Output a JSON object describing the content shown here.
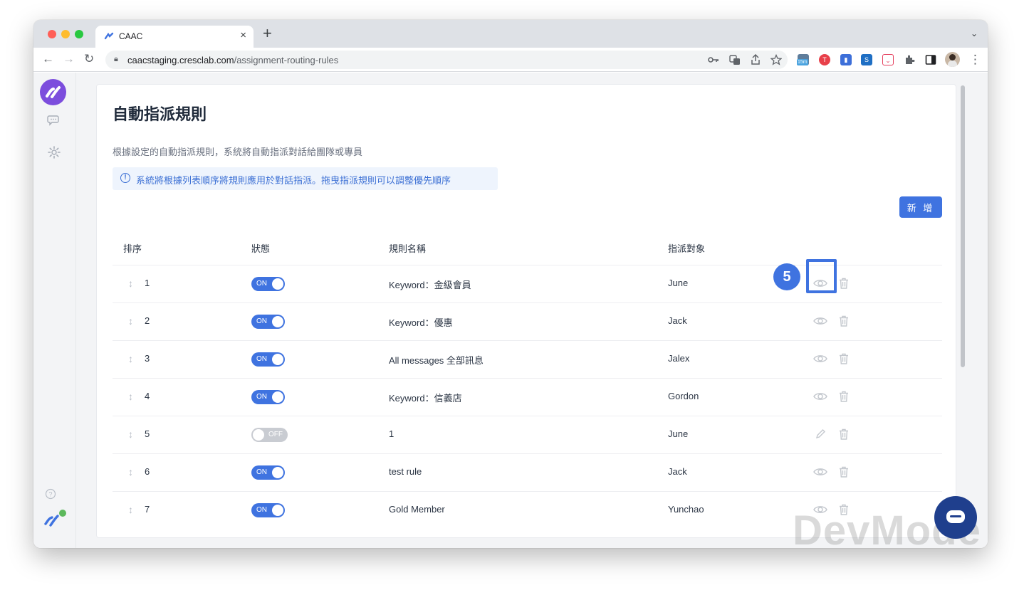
{
  "browser": {
    "tab_title": "CAAC",
    "url_host": "caacstaging.cresclab.com",
    "url_path": "/assignment-routing-rules",
    "ext_badge": "15m"
  },
  "page": {
    "title": "自動指派規則",
    "description": "根據設定的自動指派規則，系統將自動指派對話給團隊或專員",
    "info": "系統將根據列表順序將規則應用於對話指派。拖曳指派規則可以調整優先順序",
    "add_button": "新 增"
  },
  "table": {
    "headers": {
      "order": "排序",
      "status": "狀態",
      "rule_name": "規則名稱",
      "assignee": "指派對象"
    },
    "rows": [
      {
        "order": "1",
        "status": "ON",
        "name": "Keyword：金級會員",
        "assignee": "June",
        "action": "view"
      },
      {
        "order": "2",
        "status": "ON",
        "name": "Keyword：優惠",
        "assignee": "Jack",
        "action": "view"
      },
      {
        "order": "3",
        "status": "ON",
        "name": "All messages 全部訊息",
        "assignee": "Jalex",
        "action": "view"
      },
      {
        "order": "4",
        "status": "ON",
        "name": "Keyword：信義店",
        "assignee": "Gordon",
        "action": "view"
      },
      {
        "order": "5",
        "status": "OFF",
        "name": "1",
        "assignee": "June",
        "action": "edit"
      },
      {
        "order": "6",
        "status": "ON",
        "name": "test rule",
        "assignee": "Jack",
        "action": "view"
      },
      {
        "order": "7",
        "status": "ON",
        "name": "Gold Member",
        "assignee": "Yunchao",
        "action": "view"
      }
    ]
  },
  "annotation": {
    "step": "5"
  },
  "watermark": "DevMode",
  "colors": {
    "accent": "#3f73e0",
    "brand": "#7c4ddd",
    "toggle_off": "#c9ccd2",
    "info_text": "#3b6fd4"
  }
}
